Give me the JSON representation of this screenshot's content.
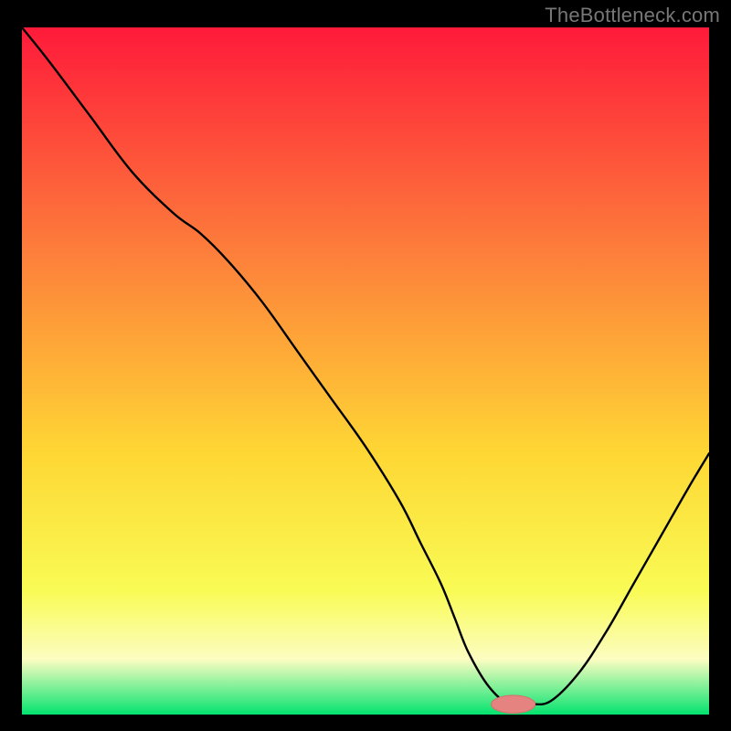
{
  "watermark": "TheBottleneck.com",
  "colors": {
    "gradient_top": "#fe1a3a",
    "gradient_upper_mid": "#fd7c3b",
    "gradient_mid": "#fed734",
    "gradient_lower_mid": "#f9fb55",
    "gradient_low": "#fcfdc1",
    "gradient_bottom": "#04e36f",
    "curve": "#000000",
    "marker_fill": "#e58381",
    "marker_stroke": "#d46f6e",
    "frame": "#000000"
  },
  "chart_data": {
    "type": "line",
    "title": "",
    "xlabel": "",
    "ylabel": "",
    "xlim": [
      0,
      100
    ],
    "ylim": [
      0,
      100
    ],
    "x": [
      0,
      4,
      10,
      16,
      22,
      26,
      30,
      35,
      40,
      45,
      50,
      55,
      58,
      61,
      63,
      65,
      68,
      71,
      74,
      77,
      81,
      85,
      89,
      93,
      97,
      100
    ],
    "values": [
      100,
      95,
      87,
      79,
      73,
      70,
      66,
      60,
      53,
      46,
      39,
      31,
      25,
      19,
      14,
      9,
      4,
      1.5,
      1.5,
      2,
      6,
      12,
      19,
      26,
      33,
      38
    ],
    "series": [
      {
        "name": "bottleneck-curve",
        "x": [
          0,
          4,
          10,
          16,
          22,
          26,
          30,
          35,
          40,
          45,
          50,
          55,
          58,
          61,
          63,
          65,
          68,
          71,
          74,
          77,
          81,
          85,
          89,
          93,
          97,
          100
        ],
        "y": [
          100,
          95,
          87,
          79,
          73,
          70,
          66,
          60,
          53,
          46,
          39,
          31,
          25,
          19,
          14,
          9,
          4,
          1.5,
          1.5,
          2,
          6,
          12,
          19,
          26,
          33,
          38
        ]
      }
    ],
    "marker": {
      "x": 71.5,
      "y": 1.5,
      "rx": 3.2,
      "ry": 1.3
    },
    "gradient_stops": [
      {
        "offset": 0,
        "key": "gradient_top"
      },
      {
        "offset": 0.32,
        "key": "gradient_upper_mid"
      },
      {
        "offset": 0.62,
        "key": "gradient_mid"
      },
      {
        "offset": 0.82,
        "key": "gradient_lower_mid"
      },
      {
        "offset": 0.92,
        "key": "gradient_low"
      },
      {
        "offset": 1.0,
        "key": "gradient_bottom"
      }
    ]
  }
}
